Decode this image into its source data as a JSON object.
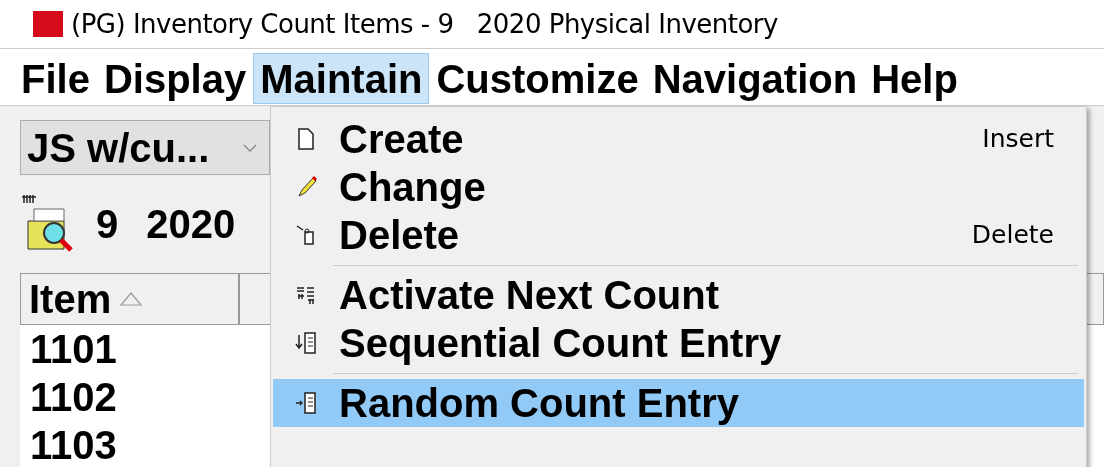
{
  "window": {
    "title": "(PG) Inventory Count Items - 9   2020 Physical Inventory"
  },
  "menu_bar": [
    {
      "label": "File",
      "selected": false
    },
    {
      "label": "Display",
      "selected": false
    },
    {
      "label": "Maintain",
      "selected": true
    },
    {
      "label": "Customize",
      "selected": false
    },
    {
      "label": "Navigation",
      "selected": false
    },
    {
      "label": "Help",
      "selected": false
    }
  ],
  "view_select": {
    "value": "JS w/cu..."
  },
  "header": {
    "number": "9",
    "year": "2020"
  },
  "table": {
    "columns": [
      {
        "label": "Item"
      }
    ],
    "rows": [
      [
        "1101"
      ],
      [
        "1102"
      ],
      [
        "1103"
      ]
    ]
  },
  "dropdown": {
    "items": [
      {
        "kind": "item",
        "label": "Create",
        "shortcut": "Insert",
        "selected": false
      },
      {
        "kind": "item",
        "label": "Change",
        "selected": false
      },
      {
        "kind": "item",
        "label": "Delete",
        "shortcut": "Delete",
        "selected": false
      },
      {
        "kind": "separator"
      },
      {
        "kind": "item",
        "label": "Activate Next Count",
        "selected": false
      },
      {
        "kind": "item",
        "label": "Sequential Count Entry",
        "selected": false
      },
      {
        "kind": "separator"
      },
      {
        "kind": "item",
        "label": "Random Count Entry",
        "selected": true
      }
    ]
  }
}
